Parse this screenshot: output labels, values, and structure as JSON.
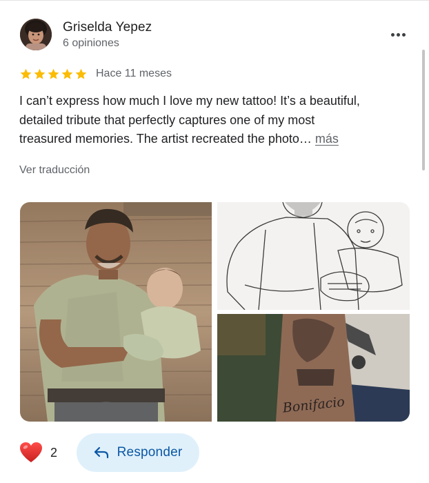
{
  "review": {
    "author": {
      "name": "Griselda Yepez",
      "meta": "6 opiniones",
      "avatar_icon": "profile-photo"
    },
    "menu_icon": "more-horizontal-icon",
    "rating": {
      "stars": 5,
      "max_stars": 5,
      "star_color": "#fbbc04",
      "date": "Hace 11 meses"
    },
    "text_lines": [
      "I can’t express how much I love my new tattoo! It’s a beautiful,",
      "detailed tribute that perfectly captures one of my most",
      "treasured memories. The artist recreated the photo…"
    ],
    "more_label": "más",
    "translate_label": "Ver traducción",
    "photos": [
      {
        "icon": "vintage-photo-man-holding-baby"
      },
      {
        "icon": "pencil-sketch-man-holding-baby"
      },
      {
        "icon": "forearm-tattoo-photo"
      }
    ],
    "photo_text": {
      "tattoo_script": "Bonifacio"
    },
    "reactions": {
      "heart_icon": "heart-icon",
      "heart_color": "#e53935",
      "count": "2"
    },
    "reply": {
      "icon": "reply-arrow-icon",
      "label": "Responder",
      "background": "#dff0fb",
      "text_color": "#0b57a4"
    }
  }
}
